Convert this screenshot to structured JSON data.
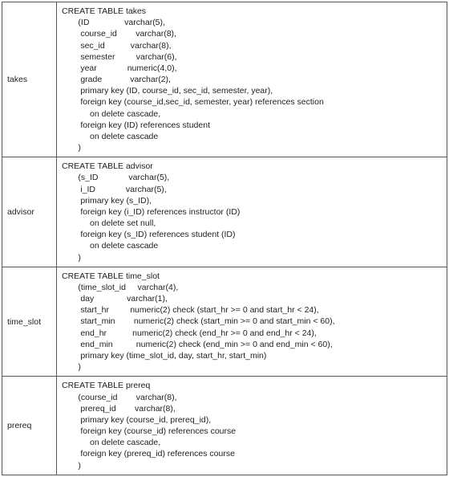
{
  "rows": [
    {
      "label": "takes",
      "sql": "CREATE TABLE takes\n       (ID               varchar(5),\n        course_id        varchar(8),\n        sec_id           varchar(8),\n        semester         varchar(6),\n        year             numeric(4,0),\n        grade            varchar(2),\n        primary key (ID, course_id, sec_id, semester, year),\n        foreign key (course_id,sec_id, semester, year) references section\n            on delete cascade,\n        foreign key (ID) references student\n            on delete cascade\n       )"
    },
    {
      "label": "advisor",
      "sql": "CREATE TABLE advisor\n       (s_ID             varchar(5),\n        i_ID             varchar(5),\n        primary key (s_ID),\n        foreign key (i_ID) references instructor (ID)\n            on delete set null,\n        foreign key (s_ID) references student (ID)\n            on delete cascade\n       )"
    },
    {
      "label": "time_slot",
      "sql": "CREATE TABLE time_slot\n       (time_slot_id     varchar(4),\n        day              varchar(1),\n        start_hr         numeric(2) check (start_hr >= 0 and start_hr < 24),\n        start_min        numeric(2) check (start_min >= 0 and start_min < 60),\n        end_hr           numeric(2) check (end_hr >= 0 and end_hr < 24),\n        end_min          numeric(2) check (end_min >= 0 and end_min < 60),\n        primary key (time_slot_id, day, start_hr, start_min)\n       )"
    },
    {
      "label": "prereq",
      "sql": "CREATE TABLE prereq\n       (course_id        varchar(8),\n        prereq_id        varchar(8),\n        primary key (course_id, prereq_id),\n        foreign key (course_id) references course\n            on delete cascade,\n        foreign key (prereq_id) references course\n       )"
    }
  ]
}
